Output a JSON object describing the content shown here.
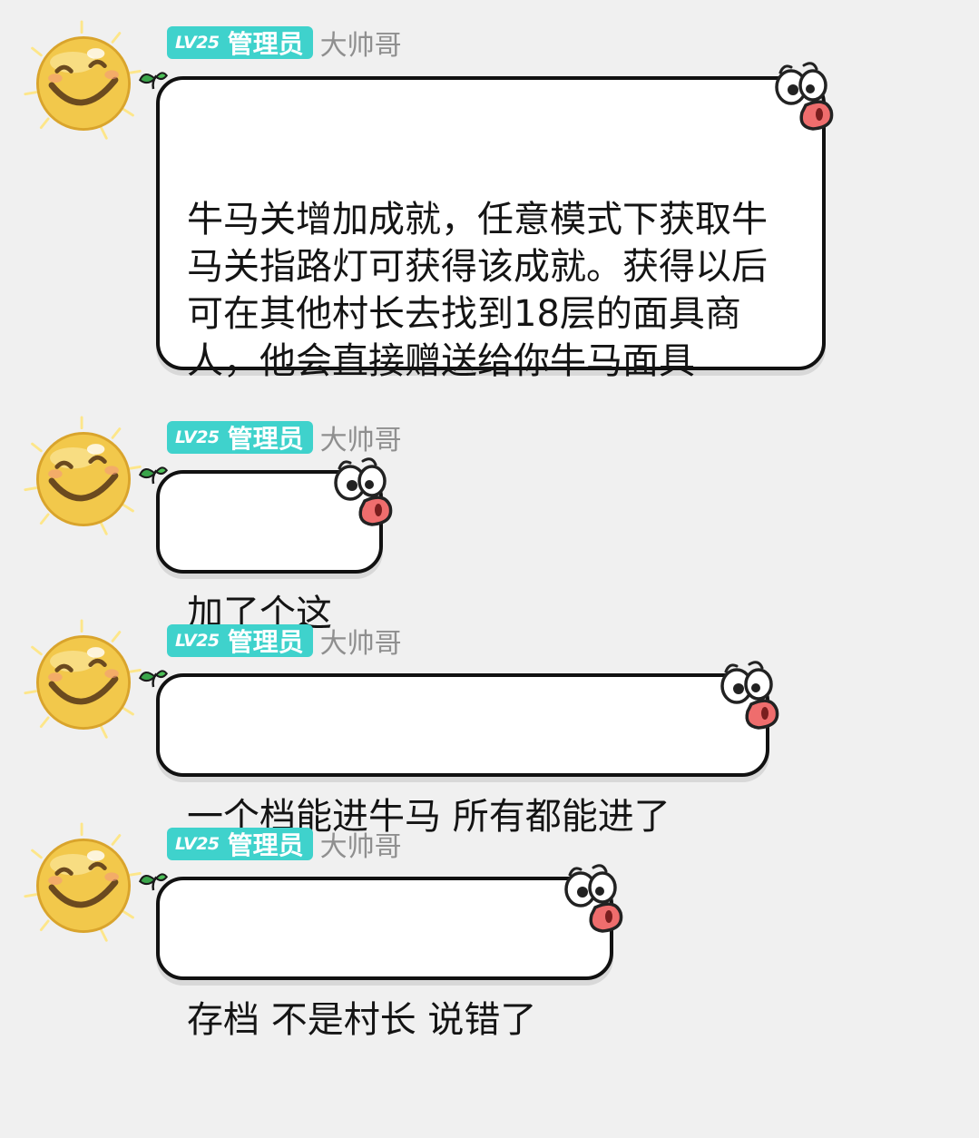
{
  "messages": [
    {
      "level": "LV25",
      "role": "管理员",
      "nickname": "大帅哥",
      "text": "牛马关增加成就，任意模式下获取牛马关指路灯可获得该成就。获得以后可在其他村长去找到18层的面具商人，他会直接赠送给你牛马面具"
    },
    {
      "level": "LV25",
      "role": "管理员",
      "nickname": "大帅哥",
      "text": "加了个这"
    },
    {
      "level": "LV25",
      "role": "管理员",
      "nickname": "大帅哥",
      "text": "一个档能进牛马 所有都能进了"
    },
    {
      "level": "LV25",
      "role": "管理员",
      "nickname": "大帅哥",
      "text": "存档 不是村长 说错了"
    }
  ],
  "colors": {
    "background": "#f0f0f0",
    "badge": "#3fd2cc",
    "nickname": "#8f8f8f",
    "bubble_border": "#111111",
    "avatar_face": "#f2c84b"
  },
  "icons": {
    "avatar": "smiley-avatar-icon",
    "bubble_corner": "cartoon-bird-icon",
    "bubble_tail": "sprout-icon"
  }
}
